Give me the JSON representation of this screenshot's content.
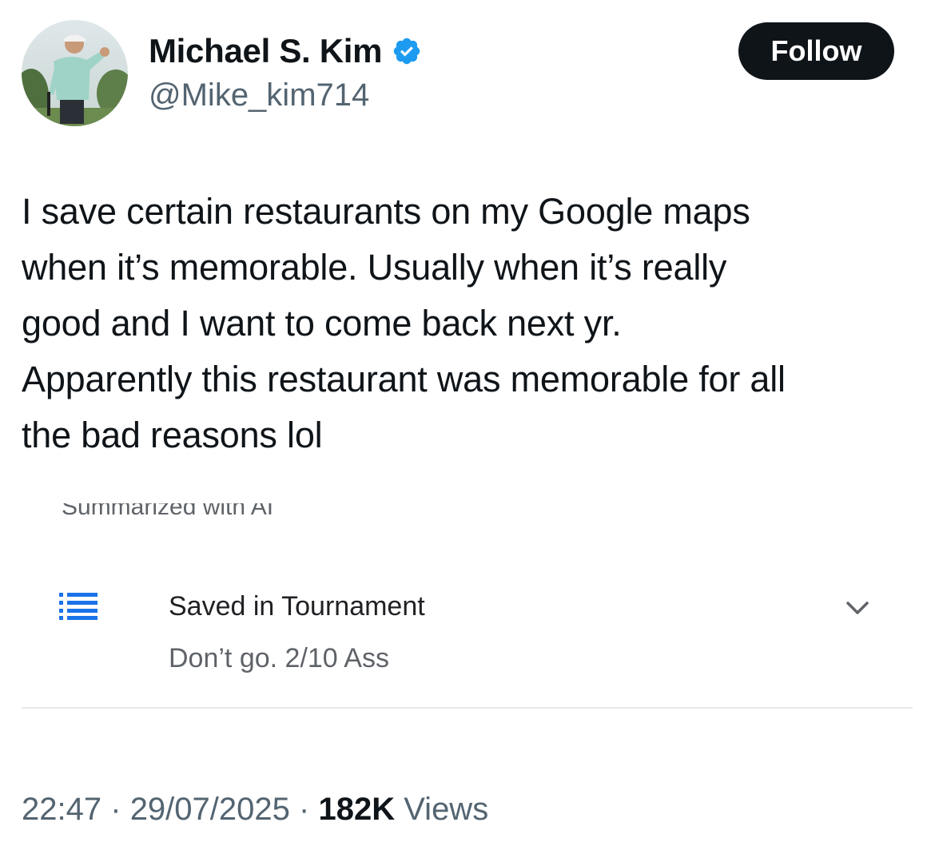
{
  "author": {
    "display_name": "Michael S. Kim",
    "handle": "@Mike_kim714",
    "verified": true,
    "avatar_icon": "golfer-avatar"
  },
  "follow_button": {
    "label": "Follow"
  },
  "tweet": {
    "lines": [
      "I save certain restaurants on my Google maps",
      "when it’s memorable. Usually when it’s really",
      "good and I want to come back next yr.",
      "Apparently this restaurant was memorable for all",
      "the bad reasons lol"
    ]
  },
  "embedded_screenshot": {
    "cut_caption": "Summarized with AI",
    "list_icon": "list-icon",
    "saved_title": "Saved in Tournament",
    "saved_note": "Don’t go. 2/10 Ass",
    "chevron_icon": "chevron-down-icon"
  },
  "meta": {
    "time": "22:47",
    "separator": "·",
    "date": "29/07/2025",
    "views_count": "182K",
    "views_label": "Views"
  },
  "colors": {
    "text_primary": "#0f1419",
    "text_secondary": "#536471",
    "verified_blue": "#1d9bf0",
    "button_bg": "#0f1419",
    "divider": "#e6e9eb"
  }
}
